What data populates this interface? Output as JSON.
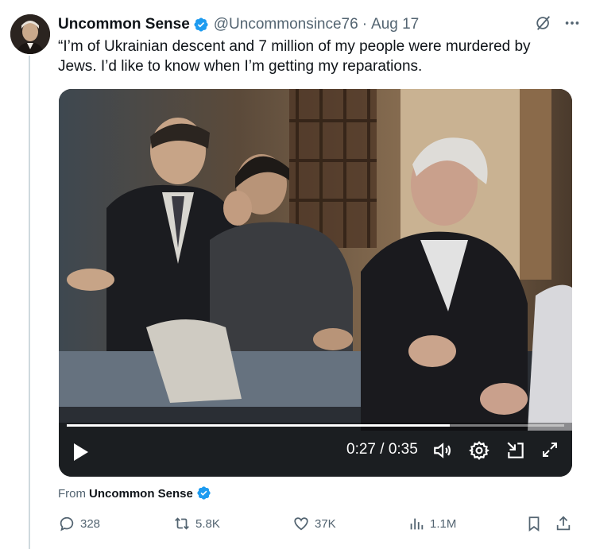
{
  "author": {
    "display_name": "Uncommon Sense",
    "handle": "@Uncommonsince76",
    "separator": "·",
    "date": "Aug 17"
  },
  "tweet": {
    "text": "“I’m of Ukrainian descent and 7 million of my people were murdered by Jews. I’d like to know when I’m getting my reparations."
  },
  "video": {
    "time": "0:27 / 0:35",
    "progress": 0.77
  },
  "from": {
    "label": "From",
    "name": "Uncommon Sense"
  },
  "actions": {
    "replies": "328",
    "reposts": "5.8K",
    "likes": "37K",
    "views": "1.1M"
  },
  "colors": {
    "verified": "#1d9bf0",
    "text": "#0f1419",
    "muted": "#536471"
  },
  "icons": [
    "grok-icon",
    "more-icon",
    "play-icon",
    "volume-icon",
    "settings-icon",
    "minimize-icon",
    "fullscreen-icon",
    "reply-icon",
    "repost-icon",
    "like-icon",
    "views-icon",
    "bookmark-icon",
    "share-icon"
  ]
}
